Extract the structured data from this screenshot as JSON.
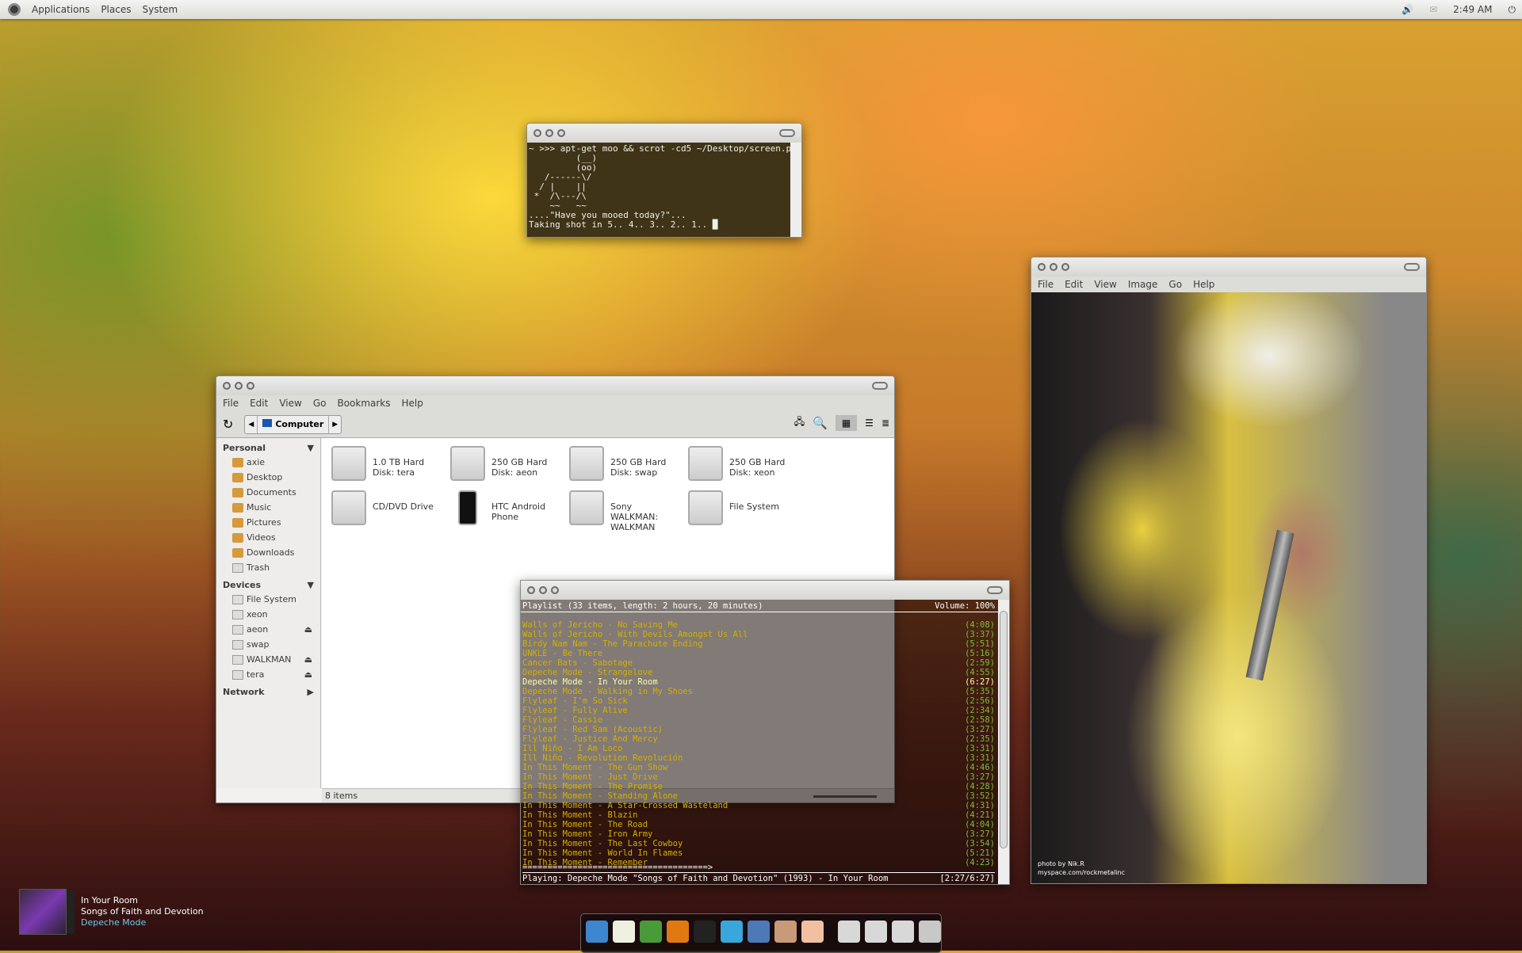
{
  "panel": {
    "menus": [
      "Applications",
      "Places",
      "System"
    ],
    "clock": "2:49 AM"
  },
  "terminal": {
    "lines": [
      "~ >>> apt-get moo && scrot -cd5 ~/Desktop/screen.png",
      "         (__)",
      "         (oo)",
      "   /------\\/",
      "  / |    ||",
      " *  /\\---/\\",
      "    ~~   ~~",
      "....\"Have you mooed today?\"...",
      "Taking shot in 5.. 4.. 3.. 2.. 1.. █"
    ]
  },
  "image_viewer": {
    "menu": [
      "File",
      "Edit",
      "View",
      "Image",
      "Go",
      "Help"
    ],
    "credit_1": "photo by Nik.R",
    "credit_2": "myspace.com/rockmetalinc"
  },
  "file_manager": {
    "menu": [
      "File",
      "Edit",
      "View",
      "Go",
      "Bookmarks",
      "Help"
    ],
    "location": "Computer",
    "sidebar": {
      "personal_label": "Personal",
      "personal": [
        "axie",
        "Desktop",
        "Documents",
        "Music",
        "Pictures",
        "Videos",
        "Downloads",
        "Trash"
      ],
      "devices_label": "Devices",
      "devices": [
        {
          "label": "File System",
          "eject": false
        },
        {
          "label": "xeon",
          "eject": false
        },
        {
          "label": "aeon",
          "eject": true
        },
        {
          "label": "swap",
          "eject": false
        },
        {
          "label": "WALKMAN",
          "eject": true
        },
        {
          "label": "tera",
          "eject": true
        }
      ],
      "network_label": "Network"
    },
    "items": [
      "1.0 TB Hard Disk: tera",
      "250 GB Hard Disk: aeon",
      "250 GB Hard Disk: swap",
      "250 GB Hard Disk: xeon",
      "CD/DVD Drive",
      "HTC Android Phone",
      "Sony WALKMAN: WALKMAN",
      "File System"
    ],
    "status": "8 items"
  },
  "player": {
    "header": "Playlist (33 items, length: 2 hours, 20 minutes)",
    "volume": "Volume: 100%",
    "current_index": 6,
    "tracks": [
      [
        "Walls of Jericho - No Saving Me",
        "(4:08)"
      ],
      [
        "Walls of Jericho - With Devils Amongst Us All",
        "(3:37)"
      ],
      [
        "Birdy Nam Nam - The Parachute Ending",
        "(5:51)"
      ],
      [
        "UNKLE - Be There",
        "(5:16)"
      ],
      [
        "Cancer Bats - Sabotage",
        "(2:59)"
      ],
      [
        "Depeche Mode - Strangelove",
        "(4:55)"
      ],
      [
        "Depeche Mode - In Your Room",
        "(6:27)"
      ],
      [
        "Depeche Mode - Walking in My Shoes",
        "(5:35)"
      ],
      [
        "Flyleaf - I'm So Sick",
        "(2:56)"
      ],
      [
        "Flyleaf - Fully Alive",
        "(2:34)"
      ],
      [
        "Flyleaf - Cassie",
        "(2:58)"
      ],
      [
        "Flyleaf - Red Sam (Acoustic)",
        "(3:27)"
      ],
      [
        "Flyleaf - Justice And Mercy",
        "(2:35)"
      ],
      [
        "Ill Niño - I Am Loco",
        "(3:31)"
      ],
      [
        "Ill Niño - Revolution Revolución",
        "(3:31)"
      ],
      [
        "In This Moment - The Gun Show",
        "(4:46)"
      ],
      [
        "In This Moment - Just Drive",
        "(3:27)"
      ],
      [
        "In This Moment - The Promise",
        "(4:28)"
      ],
      [
        "In This Moment - Standing Alone",
        "(3:52)"
      ],
      [
        "In This Moment - A Star-Crossed Wasteland",
        "(4:31)"
      ],
      [
        "In This Moment - Blazin",
        "(4:21)"
      ],
      [
        "In This Moment - The Road",
        "(4:04)"
      ],
      [
        "In This Moment - Iron Army",
        "(3:27)"
      ],
      [
        "In This Moment - The Last Cowboy",
        "(3:54)"
      ],
      [
        "In This Moment - World In Flames",
        "(5:21)"
      ],
      [
        "In This Moment - Remember",
        "(4:23)"
      ]
    ],
    "progress": "=====================================>",
    "progress_fraction": 0.38,
    "playing": "Playing: Depeche Mode \"Songs of Faith and Devotion\" (1993) - In Your Room",
    "time": "[2:27/6:27]"
  },
  "now_playing": {
    "title": "In Your Room",
    "album": "Songs of Faith and Devotion",
    "artist": "Depeche Mode"
  },
  "dock": {
    "apps": [
      "anchor",
      "text-editor",
      "keyring",
      "eye-of-gnome",
      "terminal",
      "twitter",
      "tools",
      "nautilus-shell",
      "eye"
    ],
    "devices": [
      "drive",
      "usb",
      "drive",
      "trash"
    ],
    "colors": [
      "#3d86d0",
      "#f0f0e0",
      "#4a9a3a",
      "#e07a10",
      "#222222",
      "#39a7dc",
      "#4d79b8",
      "#c89a78",
      "#f0c0a0",
      "#d8d8d8",
      "#d8d8d8",
      "#d8d8d8",
      "#c8c8c8"
    ]
  },
  "colors": {
    "track": "#d4b000",
    "current": "#ffffa0",
    "duration": "#7ac034",
    "terminal_bg": "#3f3318"
  }
}
